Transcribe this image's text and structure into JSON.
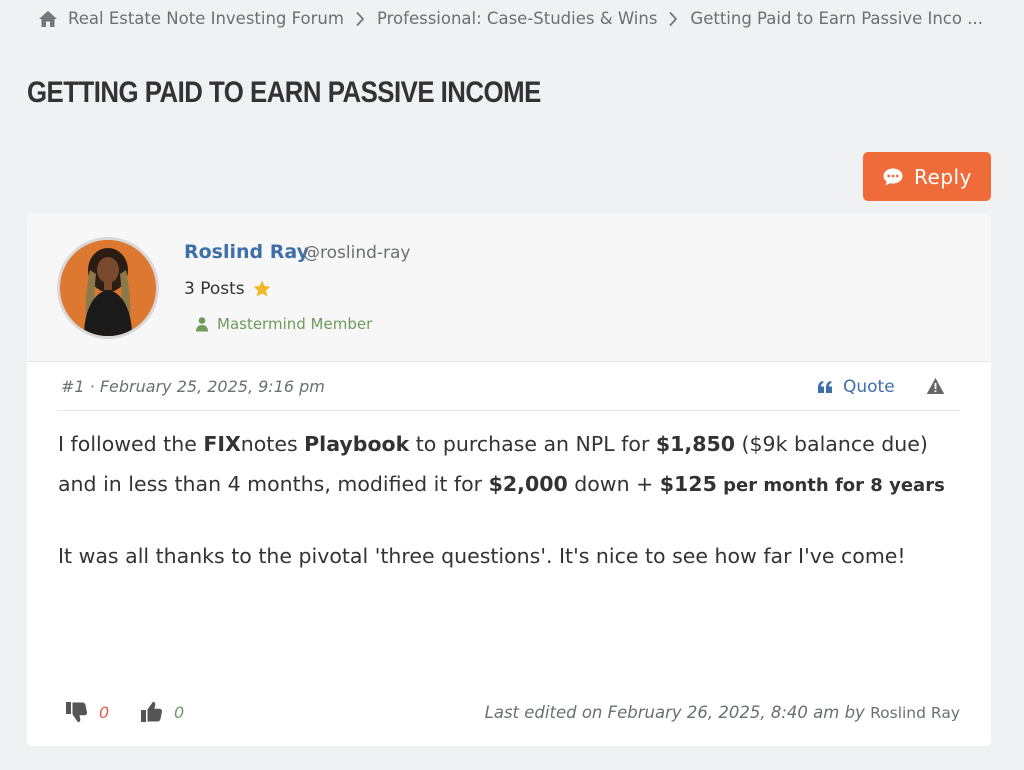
{
  "breadcrumb": {
    "items": [
      "Real Estate Note Investing Forum",
      "Professional: Case-Studies & Wins",
      "Getting Paid to Earn Passive Inco ..."
    ]
  },
  "topic": {
    "title": "GETTING PAID TO EARN PASSIVE INCOME",
    "reply_label": "Reply"
  },
  "author": {
    "name": "Roslind Ray",
    "handle": "@roslind-ray",
    "posts": "3 Posts",
    "role": "Mastermind Member"
  },
  "post": {
    "meta": "#1 · February 25, 2025, 9:16 pm",
    "quote_label": "Quote",
    "body": {
      "p1": [
        "I followed the ",
        "FIX",
        "notes ",
        "Playbook",
        " to purchase an NPL for ",
        "$1,850",
        " ($9k balance due) and in less than 4 months, modified it for ",
        "$2,000",
        " down + ",
        "$125",
        " per month for 8 years"
      ],
      "p2": "It was all thanks to the pivotal 'three questions'. It's nice to see how far I've come!"
    },
    "dislikes": "0",
    "likes": "0",
    "last_edited_prefix": "Last edited on February 26, 2025, 8:40 am by ",
    "last_edited_by": "Roslind Ray"
  },
  "colors": {
    "accent": "#ef6b3a",
    "link": "#3d6fa8",
    "member": "#6e9a5a",
    "dislike": "#e05b4b"
  },
  "icons": [
    "home-icon",
    "chevron-right-icon",
    "reply-icon",
    "star-icon",
    "member-icon",
    "quote-icon",
    "report-icon",
    "thumbs-down-icon",
    "thumbs-up-icon"
  ]
}
